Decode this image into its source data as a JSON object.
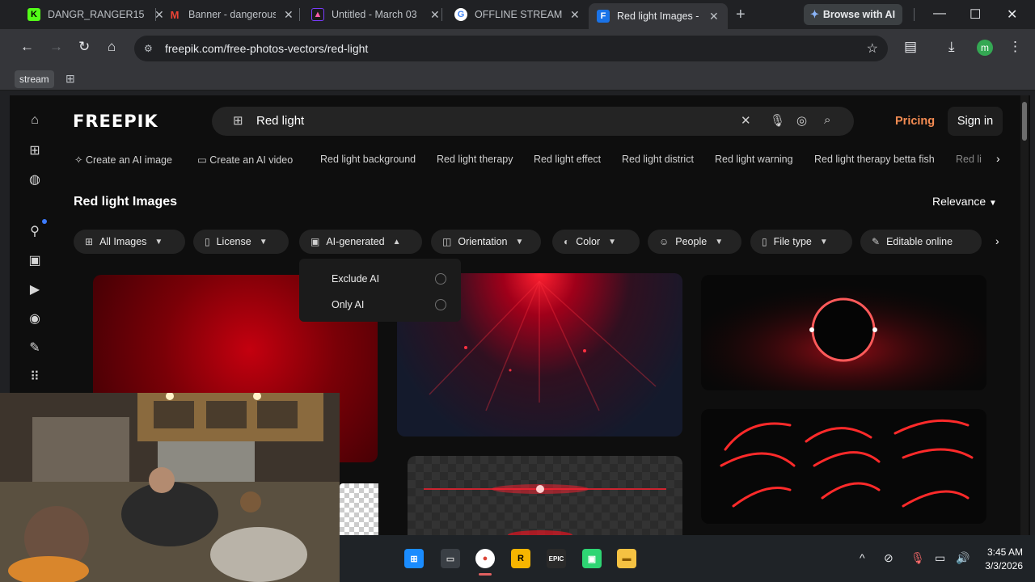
{
  "browser": {
    "tabs": [
      {
        "title": "DANGR_RANGER15",
        "favicon": "kick-logo-icon",
        "active": false
      },
      {
        "title": "Banner - dangerous",
        "favicon": "gmail-icon",
        "active": false
      },
      {
        "title": "Untitled - March 03",
        "favicon": "canva-icon",
        "active": false
      },
      {
        "title": "OFFLINE STREAM B",
        "favicon": "google-icon",
        "active": false
      },
      {
        "title": "Red light Images - F",
        "favicon": "freepik-icon",
        "active": true
      }
    ],
    "browse_with_ai": "Browse with AI",
    "url": "freepik.com/free-photos-vectors/red-light",
    "bookmarks": {
      "stream": "stream"
    },
    "profile_initial": "m"
  },
  "site": {
    "logo": "FREEPIK",
    "search": {
      "value": "Red light"
    },
    "pricing": "Pricing",
    "signin": "Sign in",
    "related": [
      "Create an AI image",
      "Create an AI video",
      "Red light background",
      "Red light therapy",
      "Red light effect",
      "Red light district",
      "Red light warning",
      "Red light therapy betta fish",
      "Red li"
    ],
    "heading": "Red light Images",
    "sort": "Relevance",
    "filters": [
      "All Images",
      "License",
      "AI-generated",
      "Orientation",
      "Color",
      "People",
      "File type",
      "Editable online"
    ],
    "ai_dropdown": {
      "options": [
        "Exclude AI",
        "Only AI"
      ]
    }
  },
  "taskbar": {
    "time": "3:45 AM",
    "date": "3/3/2026"
  },
  "colors": {
    "accent": "#f38b52",
    "page_bg": "#0e0e0e",
    "chip_bg": "#232323"
  }
}
